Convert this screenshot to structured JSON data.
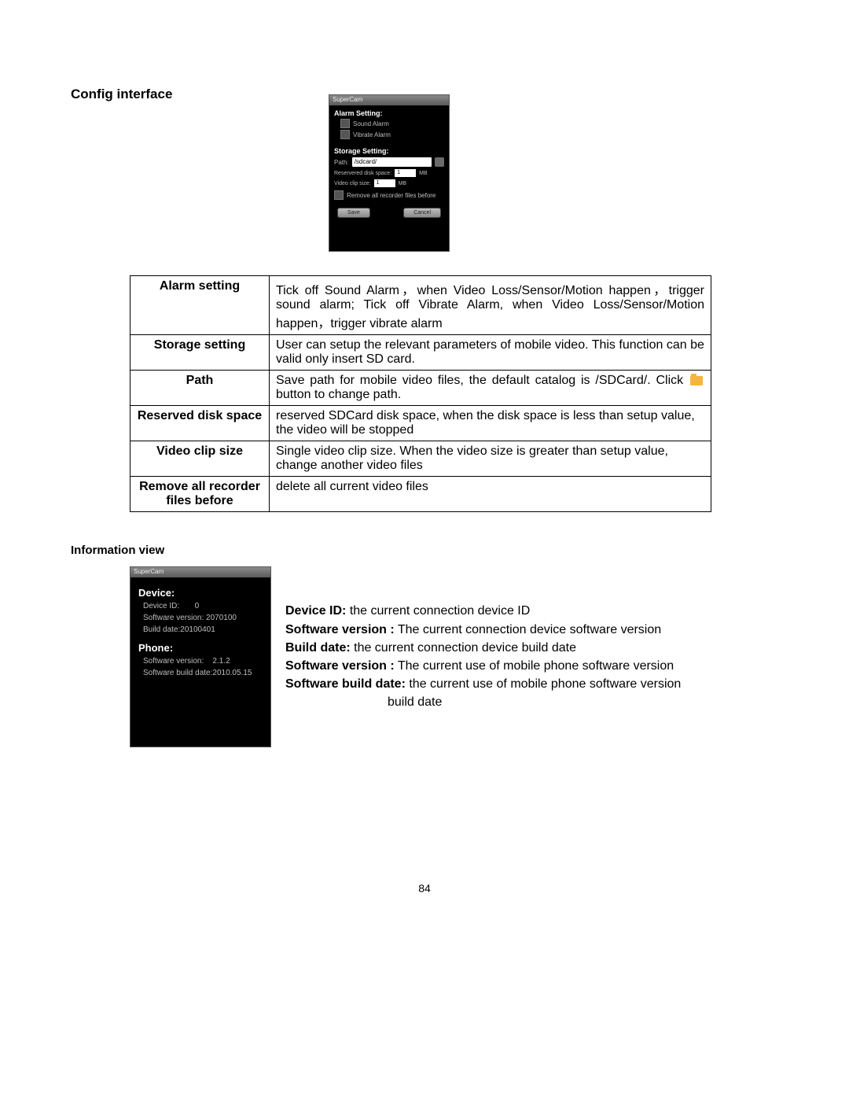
{
  "headings": {
    "config_interface": "Config interface",
    "information_view": "Information view"
  },
  "phone_config": {
    "title": "SuperCam",
    "alarm_heading": "Alarm Setting:",
    "sound_alarm": "Sound Alarm",
    "vibrate_alarm": "Vibrate Alarm",
    "storage_heading": "Storage Setting:",
    "path_label": "Path:",
    "path_value": "/sdcard/",
    "reserved_label": "Reservered disk space:",
    "reserved_value": "1",
    "reserved_unit": "MB",
    "clip_label": "Video clip size:",
    "clip_value": "1",
    "clip_unit": "MB",
    "remove_label": "Remove all recorder files before",
    "save_btn": "Save",
    "cancel_btn": "Cancel"
  },
  "config_table": {
    "rows": [
      {
        "label": "Alarm setting",
        "desc_lines": [
          "Tick off Sound Alarm，when Video Loss/Sensor/Motion happen，trigger sound alarm; Tick off Vibrate Alarm, when Video Loss/Sensor/Motion happen，trigger vibrate alarm"
        ]
      },
      {
        "label": "Storage setting",
        "desc_lines": [
          "User can setup the relevant parameters of mobile video. This function can be valid only insert SD card."
        ]
      },
      {
        "label": "Path",
        "desc_pre": "Save path for mobile video files, the default catalog is /SDCard/. Click ",
        "desc_post": " button to change path."
      },
      {
        "label": "Reserved disk space",
        "desc_lines": [
          "reserved SDCard disk space, when the disk space is less than setup value, the video will be stopped"
        ]
      },
      {
        "label": "Video clip size",
        "desc_lines": [
          "Single video clip size. When the video size is greater than setup value, change another video files"
        ]
      },
      {
        "label": "Remove all recorder files before",
        "desc_lines": [
          "delete all current video files"
        ]
      }
    ]
  },
  "phone_info": {
    "title": "SuperCam",
    "device_heading": "Device:",
    "device_id_label": "Device ID:",
    "device_id_value": "0",
    "device_sw_label": "Software version:",
    "device_sw_value": "2070100",
    "device_build_label": "Build date:",
    "device_build_value": "20100401",
    "phone_heading": "Phone:",
    "phone_sw_label": "Software version:",
    "phone_sw_value": "2.1.2",
    "phone_build_label": "Software build date:",
    "phone_build_value": "2010.05.15"
  },
  "info_text": {
    "l1_b": "Device ID:",
    "l1_r": " the current connection device ID",
    "l2_b": "Software version :",
    "l2_r": " The current connection device software version",
    "l3_b": "Build date:",
    "l3_r": " the current connection device build date",
    "l4_b": "Software version :",
    "l4_r": " The current use of mobile phone software version",
    "l5_b": "Software build date:",
    "l5_r": " the current use of mobile phone software version",
    "l5_r2": "build date"
  },
  "page_number": "84"
}
